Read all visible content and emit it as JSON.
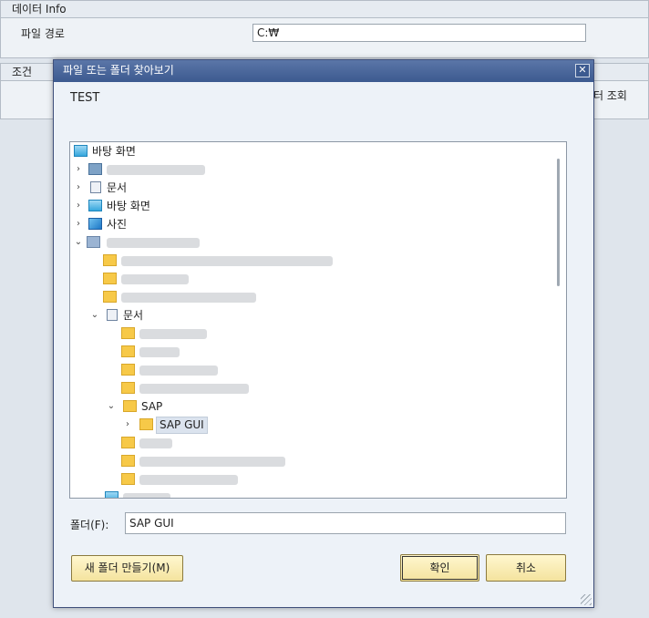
{
  "background": {
    "data_section_title": "데이터 Info",
    "file_path_label": "파일 경로",
    "file_path_value": "C:₩",
    "condition_section_title": "조건",
    "partial_button_text": "터 조회"
  },
  "dialog": {
    "title": "파일 또는 폴더 찾아보기",
    "close_glyph": "✕",
    "description": "TEST",
    "tree": {
      "root": "바탕 화면",
      "documents": "문서",
      "desktop": "바탕 화면",
      "pictures": "사진",
      "documents_expanded": "문서",
      "sap": "SAP",
      "sap_gui": "SAP GUI"
    },
    "folder_label": "폴더(F):",
    "folder_value": "SAP GUI",
    "new_folder_button": "새 폴더 만들기(M)",
    "ok_button": "확인",
    "cancel_button": "취소"
  },
  "colors": {
    "title_bar": "#3c5a90",
    "button_fill": "#f4e39e",
    "folder_icon": "#f7c948"
  }
}
